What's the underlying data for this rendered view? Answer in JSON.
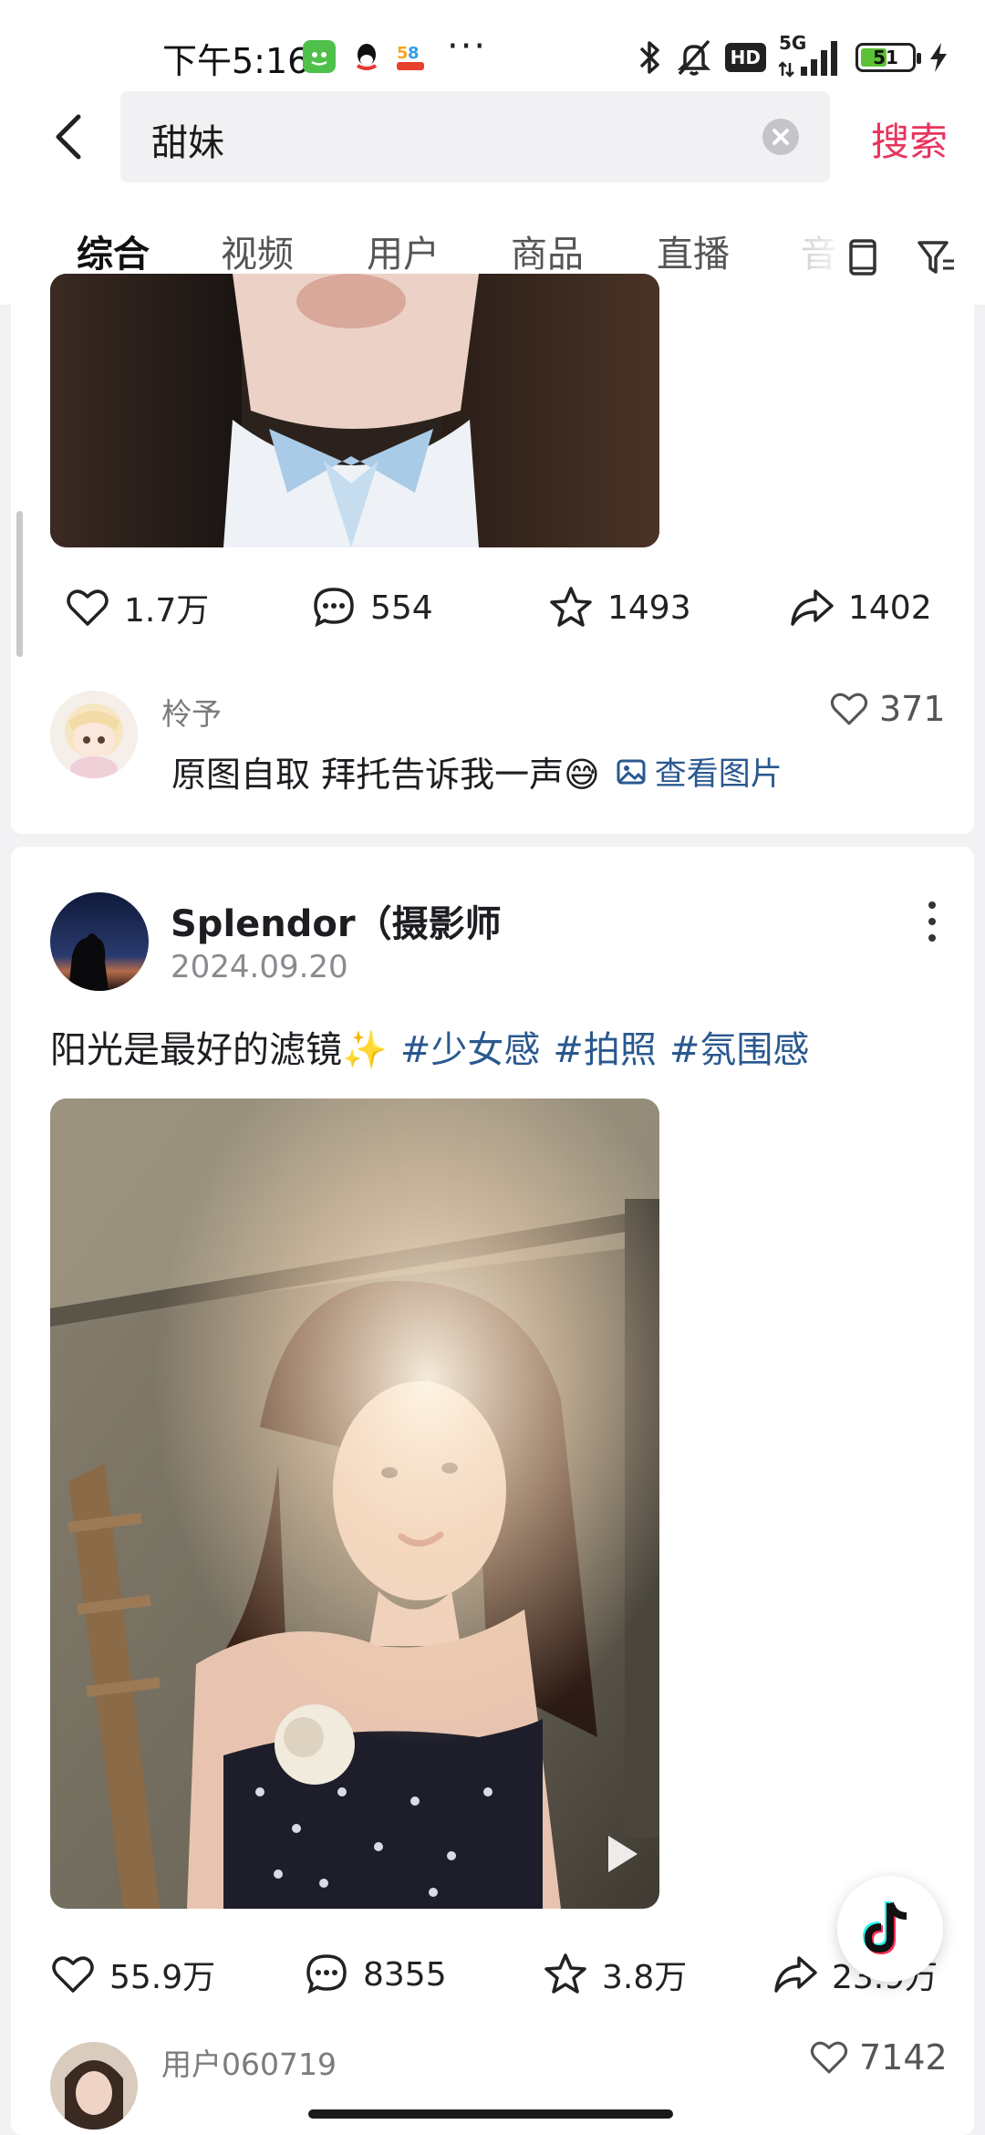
{
  "status_bar": {
    "time": "下午5:16",
    "network": "5G",
    "battery": "51",
    "battery_percent": 51,
    "accent": "#5bc236"
  },
  "search": {
    "query": "甜妹",
    "search_label": "搜索",
    "accent": "#e8345e"
  },
  "tabs": [
    {
      "label": "综合"
    },
    {
      "label": "视频"
    },
    {
      "label": "用户"
    },
    {
      "label": "商品"
    },
    {
      "label": "直播"
    },
    {
      "label": "音"
    }
  ],
  "post1": {
    "actions": {
      "likes": "1.7万",
      "comments": "554",
      "favorites": "1493",
      "shares": "1402"
    },
    "top_comment": {
      "user": "柃予",
      "likes": "371",
      "text": "原图自取 拜托告诉我一声😅",
      "view_image_label": "查看图片"
    }
  },
  "post2": {
    "author": "Splendor（摄影师",
    "date": "2024.09.20",
    "caption": "阳光是最好的滤镜✨",
    "hashtags": [
      "#少女感",
      "#拍照",
      "#氛围感"
    ],
    "actions": {
      "likes": "55.9万",
      "comments": "8355",
      "favorites": "3.8万",
      "shares": "23.9万"
    },
    "top_comment": {
      "user": "用户060719",
      "likes": "7142"
    }
  },
  "icons": [
    "back-icon",
    "clear-icon",
    "phone-icon",
    "filter-icon",
    "heart-icon",
    "comment-icon",
    "star-icon",
    "share-icon",
    "play-icon",
    "more-icon",
    "douyin-icon",
    "image-icon",
    "bluetooth-icon",
    "mute-icon",
    "signal-icon",
    "charging-icon"
  ],
  "colors": {
    "link": "#2a5890",
    "background": "#f2f2f4"
  }
}
